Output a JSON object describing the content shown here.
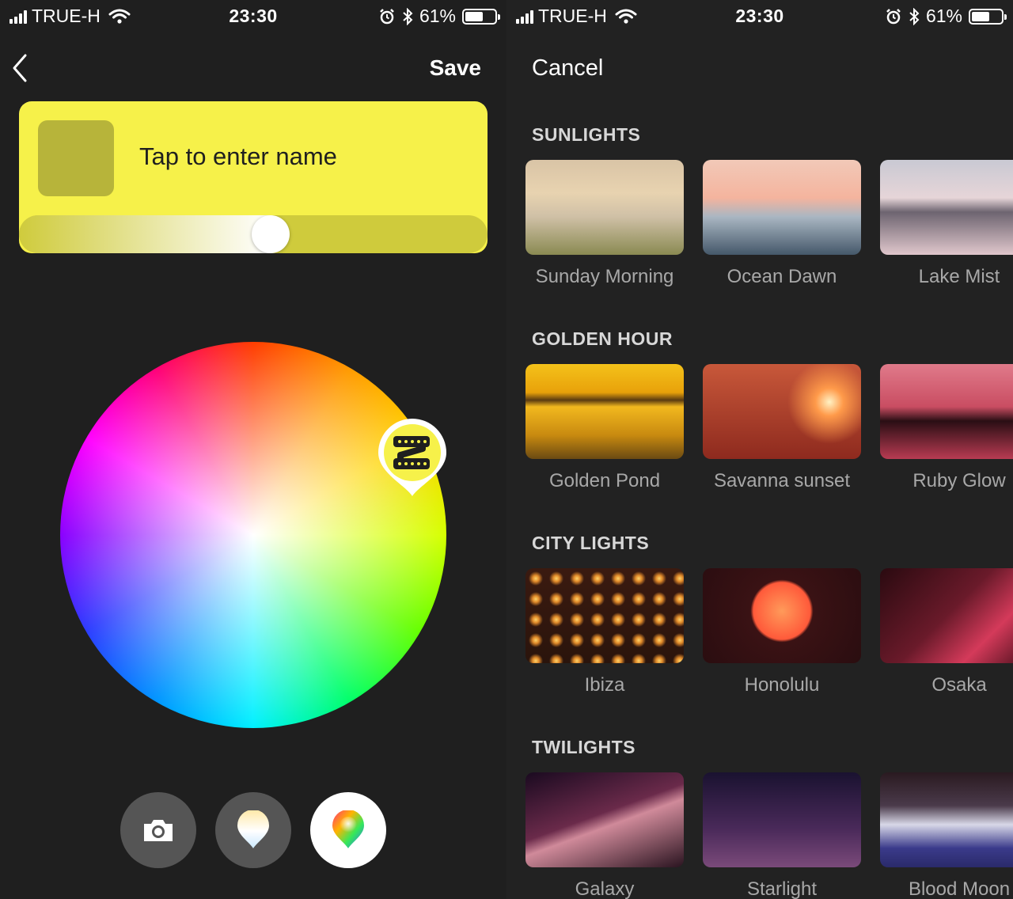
{
  "status_bar": {
    "carrier": "TRUE-H",
    "time": "23:30",
    "battery": "61%",
    "battery_level": 0.61
  },
  "editor": {
    "save_label": "Save",
    "name_placeholder": "Tap to enter name",
    "brightness": 0.54,
    "card_color": "#f6f14a",
    "modes": [
      {
        "name": "camera-icon",
        "active": false
      },
      {
        "name": "white-light-pin-icon",
        "active": false
      },
      {
        "name": "color-pin-icon",
        "active": true
      }
    ]
  },
  "gallery": {
    "cancel_label": "Cancel",
    "sections": [
      {
        "title": "SUNLIGHTS",
        "scenes": [
          "Sunday Morning",
          "Ocean Dawn",
          "Lake Mist"
        ]
      },
      {
        "title": "GOLDEN HOUR",
        "scenes": [
          "Golden Pond",
          "Savanna sunset",
          "Ruby Glow"
        ]
      },
      {
        "title": "CITY LIGHTS",
        "scenes": [
          "Ibiza",
          "Honolulu",
          "Osaka"
        ]
      },
      {
        "title": "TWILIGHTS",
        "scenes": [
          "Galaxy",
          "Starlight",
          "Blood Moon"
        ]
      }
    ]
  }
}
